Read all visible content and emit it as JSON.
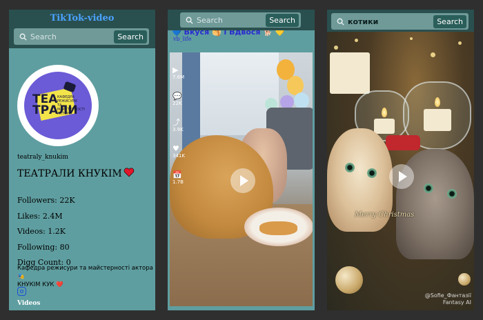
{
  "profile_panel": {
    "app_title": "TikTok-video",
    "search": {
      "placeholder": "Search",
      "value": "",
      "button_label": "Search"
    },
    "avatar_text": {
      "logo_line1": "TEA",
      "logo_line2": "ТРАЛИ",
      "logo_subtitle": "КАФЕДРА РЕЖИСУРИ ТА МАЙСТЕРНОСТІ АКТОРА"
    },
    "handle": "teatraly_knukim",
    "display_name": "ТЕАТРАЛИ КНУКІМ",
    "heart_icon": "red-heart-emoji",
    "stats": {
      "followers": "Followers: 22K",
      "likes": "Likes: 2.4M",
      "videos": "Videos: 1.2K",
      "following": "Following: 80",
      "digg_count": "Digg Count: 0"
    },
    "bio_line1": "Кафедра режисури та майстерності актора 🎭",
    "bio_line2": "КНУКІМ КУК ❤️",
    "social_icon": "instagram-icon",
    "videos_link": "Videos"
  },
  "video_panel": {
    "search": {
      "placeholder": "Search",
      "value": "",
      "button_label": "Search"
    },
    "video_title": "💙 Вкуся 🥞 і Вдвося 🐕 💛",
    "video_user": "vb_life",
    "side_stats": [
      {
        "icon": "play-icon",
        "glyph": "▶",
        "value": "7.6M"
      },
      {
        "icon": "comment-icon",
        "glyph": "💬",
        "value": "22K"
      },
      {
        "icon": "share-icon",
        "glyph": "⤴",
        "value": "3.9K"
      },
      {
        "icon": "heart-icon",
        "glyph": "♥",
        "value": "341K"
      },
      {
        "icon": "calendar-icon",
        "glyph": "📅",
        "value": "1.7B"
      }
    ]
  },
  "search_panel": {
    "search": {
      "placeholder": "Search",
      "value": "котики",
      "button_label": "Search"
    },
    "video_caption": "Merry Christmas",
    "watermark_line1": "@Sofie_Фантазії",
    "watermark_line2": "Fantasy AI"
  },
  "colors": {
    "page_bg": "#2f2f2f",
    "panel_bg": "#5f9ea0",
    "topbar_bg": "#2a4f4f",
    "title_accent": "#4aa3ff",
    "search_button_bg": "#2a5e5a",
    "link_color": "#2a2acf"
  }
}
